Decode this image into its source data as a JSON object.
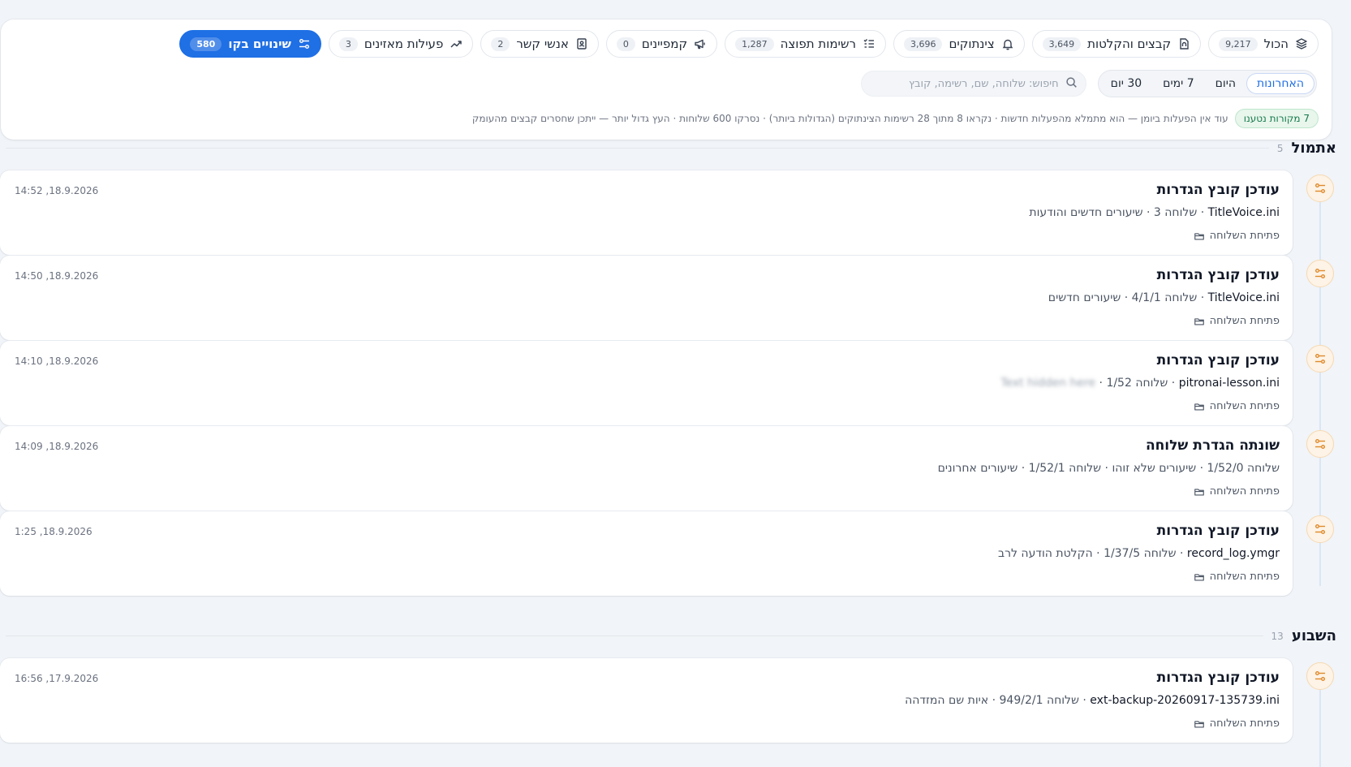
{
  "filters": {
    "chips": [
      {
        "label": "הכול",
        "count": "9,217",
        "icon": "layers-icon",
        "active": false
      },
      {
        "label": "קבצים והקלטות",
        "count": "3,649",
        "icon": "file-audio-icon",
        "active": false
      },
      {
        "label": "צינתוקים",
        "count": "3,696",
        "icon": "bell-icon",
        "active": false
      },
      {
        "label": "רשימות תפוצה",
        "count": "1,287",
        "icon": "list-check-icon",
        "active": false
      },
      {
        "label": "קמפיינים",
        "count": "0",
        "icon": "megaphone-icon",
        "active": false
      },
      {
        "label": "אנשי קשר",
        "count": "2",
        "icon": "contacts-book-icon",
        "active": false
      },
      {
        "label": "פעילות מאזינים",
        "count": "3",
        "icon": "trend-up-icon",
        "active": false
      },
      {
        "label": "שינויים בקו",
        "count": "580",
        "icon": "settings-sliders-icon",
        "active": true
      }
    ],
    "time_tabs": [
      {
        "label": "האחרונות",
        "active": true
      },
      {
        "label": "היום",
        "active": false
      },
      {
        "label": "7 ימים",
        "active": false
      },
      {
        "label": "30 יום",
        "active": false
      }
    ],
    "search_placeholder": "חיפוש: שלוחה, שם, רשימה, קובץ",
    "sources_badge": "7 מקורות נטענו",
    "info": "עוד אין הפעלות ביומן — הוא מתמלא מהפעלות חדשות · נקראו 8 מתוך 28 רשימות הצינתוקים (הגדולות ביותר) · נסרקו 600 שלוחות · העץ גדול יותר — ייתכן שחסרים קבצים מהעומק"
  },
  "sections": [
    {
      "title": "אתמול",
      "count": "5",
      "items": [
        {
          "title": "עודכן קובץ הגדרות",
          "file": "TitleVoice.ini",
          "details": "שלוחה 3 · שיעורים חדשים והודעות",
          "blurred": "",
          "link": "פתיחת השלוחה",
          "time": "14:52 ,18.9.2026"
        },
        {
          "title": "עודכן קובץ הגדרות",
          "file": "TitleVoice.ini",
          "details": "שלוחה 4/1/1 · שיעורים חדשים",
          "blurred": "",
          "link": "פתיחת השלוחה",
          "time": "14:50 ,18.9.2026"
        },
        {
          "title": "עודכן קובץ הגדרות",
          "file": "pitronai-lesson.ini",
          "details": "שלוחה 1/52 ·",
          "blurred": "Text hidden here",
          "link": "פתיחת השלוחה",
          "time": "14:10 ,18.9.2026"
        },
        {
          "title": "שונתה הגדרת שלוחה",
          "file": "",
          "details": "שלוחה 1/52/0 · שיעורים שלא זוהו · שלוחה 1/52/1 · שיעורים אחרונים",
          "blurred": "",
          "link": "פתיחת השלוחה",
          "time": "14:09 ,18.9.2026"
        },
        {
          "title": "עודכן קובץ הגדרות",
          "file": "record_log.ymgr",
          "details": "שלוחה 1/37/5 · הקלטת הודעה לרב",
          "blurred": "",
          "link": "פתיחת השלוחה",
          "time": "1:25 ,18.9.2026"
        }
      ]
    },
    {
      "title": "השבוע",
      "count": "13",
      "items": [
        {
          "title": "עודכן קובץ הגדרות",
          "file": "ext-backup-20260917-135739.ini",
          "details": "שלוחה 949/2/1 · איות שם המזדהה",
          "blurred": "",
          "link": "פתיחת השלוחה",
          "time": "16:56 ,17.9.2026"
        }
      ]
    }
  ],
  "colors": {
    "accent": "#1f6fe5",
    "timeline_icon": "#e08a2c",
    "sources_badge": "#16794b"
  }
}
